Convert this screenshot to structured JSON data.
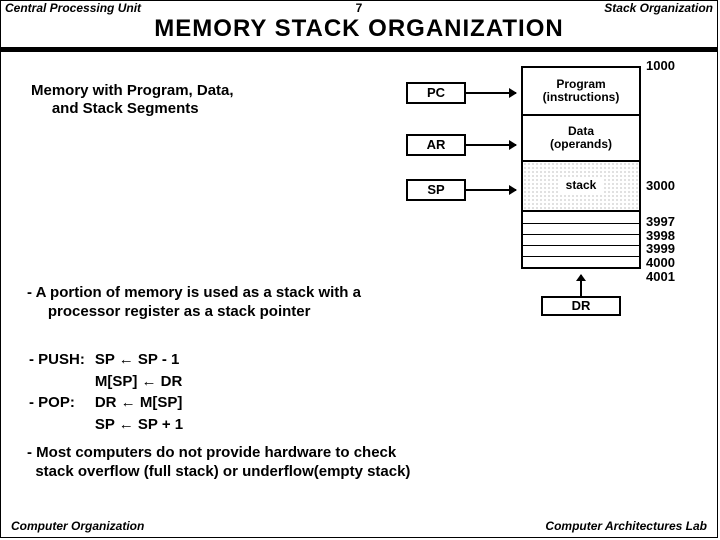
{
  "header": {
    "left": "Central Processing Unit",
    "center": "7",
    "right": "Stack Organization"
  },
  "title": "MEMORY  STACK  ORGANIZATION",
  "subtitle_l1": "Memory with Program, Data,",
  "subtitle_l2": "and Stack Segments",
  "registers": {
    "pc": "PC",
    "ar": "AR",
    "sp": "SP",
    "dr": "DR"
  },
  "segments": {
    "program_l1": "Program",
    "program_l2": "(instructions)",
    "data_l1": "Data",
    "data_l2": "(operands)",
    "stack": "stack"
  },
  "addresses": {
    "top": "1000",
    "stack_start": "3000",
    "list": [
      "3997",
      "3998",
      "3999",
      "4000",
      "4001"
    ]
  },
  "bullets": {
    "b1_l1": "- A portion of memory is used as a stack with a",
    "b1_l2": "processor register as a stack pointer",
    "push_label": "- PUSH:",
    "push_1": "SP ← SP - 1",
    "push_2": "M[SP] ← DR",
    "pop_label": "- POP:",
    "pop_1": "DR ← M[SP]",
    "pop_2": "SP ← SP + 1",
    "b2_l1": "- Most computers do not provide hardware to check",
    "b2_l2": "stack overflow (full stack) or underflow(empty stack)"
  },
  "footer": {
    "left": "Computer Organization",
    "right": "Computer Architectures Lab"
  }
}
